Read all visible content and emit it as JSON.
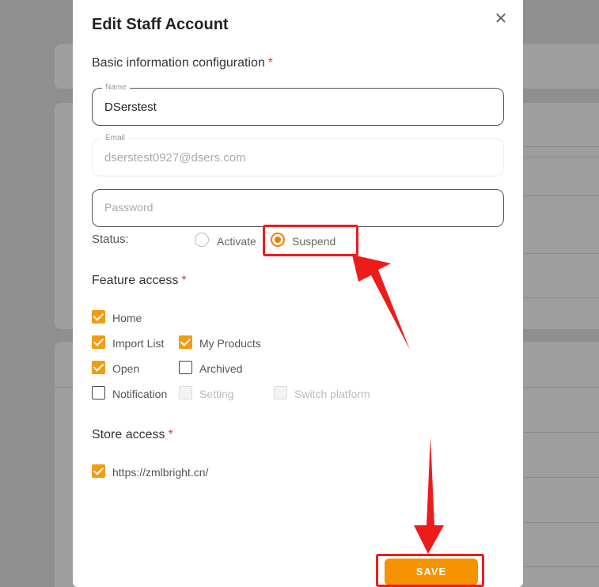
{
  "modal": {
    "title": "Edit Staff Account",
    "close_icon": "close-icon",
    "basic_section": {
      "title": "Basic information configuration",
      "required_mark": "*"
    },
    "name_field": {
      "label": "Name",
      "value": "DSerstest"
    },
    "email_field": {
      "label": "Email",
      "value": "dserstest0927@dsers.com"
    },
    "password_field": {
      "placeholder": "Password",
      "value": ""
    },
    "status": {
      "label": "Status:",
      "options": [
        {
          "label": "Activate",
          "selected": false
        },
        {
          "label": "Suspend",
          "selected": true
        }
      ]
    },
    "feature_section": {
      "title": "Feature access",
      "required_mark": "*"
    },
    "features": [
      {
        "label": "Home",
        "checked": true,
        "disabled": false
      },
      {
        "label": "Import List",
        "checked": true,
        "disabled": false
      },
      {
        "label": "My Products",
        "checked": true,
        "disabled": false
      },
      {
        "label": "Open",
        "checked": true,
        "disabled": false
      },
      {
        "label": "Archived",
        "checked": false,
        "disabled": false
      },
      {
        "label": "Notification",
        "checked": false,
        "disabled": false
      },
      {
        "label": "Setting",
        "checked": false,
        "disabled": true
      },
      {
        "label": "Switch platform",
        "checked": false,
        "disabled": true
      }
    ],
    "store_section": {
      "title": "Store access",
      "required_mark": "*"
    },
    "stores": [
      {
        "label": "https://zmlbright.cn/",
        "checked": true
      }
    ],
    "save_label": "SAVE"
  },
  "colors": {
    "accent": "#f59300",
    "highlight": "#ee1c1c",
    "required": "#e53935"
  }
}
